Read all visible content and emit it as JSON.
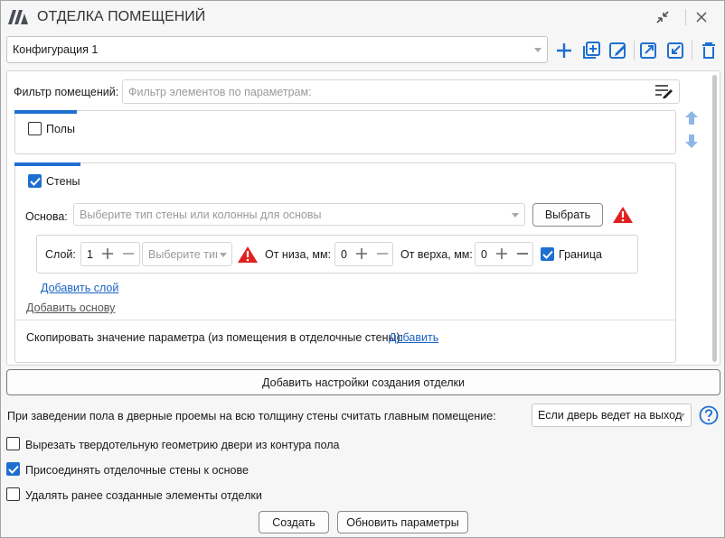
{
  "window": {
    "title": "ОТДЕЛКА ПОМЕЩЕНИЙ"
  },
  "config": {
    "selected": "Конфигурация 1"
  },
  "filter": {
    "label": "Фильтр помещений:",
    "placeholder": "Фильтр элементов по параметрам:"
  },
  "sections": {
    "floors": {
      "label": "Полы",
      "checked": false
    },
    "walls": {
      "label": "Стены",
      "checked": true,
      "base_label": "Основа:",
      "base_placeholder": "Выберите тип стены или колонны для основы",
      "choose_button": "Выбрать",
      "layer": {
        "label": "Слой:",
        "value": "1",
        "type_placeholder": "Выберите тип",
        "bottom_label": "От низа, мм:",
        "bottom_value": "0",
        "top_label": "От верха, мм:",
        "top_value": "0",
        "border_label": "Граница",
        "border_checked": true
      },
      "add_layer": "Добавить слой",
      "add_base": "Добавить основу",
      "copy_param_text": "Скопировать значение параметра (из помещения в отделочные стены):",
      "copy_param_link": "Добавить"
    }
  },
  "add_settings_button": "Добавить настройки создания отделки",
  "door_option": {
    "text": "При заведении пола в дверные проемы на всю толщину стены считать главным помещение:",
    "selected": "Если дверь ведет на выход"
  },
  "options": [
    {
      "label": "Вырезать твердотельную геометрию двери из контура пола",
      "checked": false
    },
    {
      "label": "Присоединять отделочные стены к основе",
      "checked": true
    },
    {
      "label": "Удалять ранее созданные элементы отделки",
      "checked": false
    }
  ],
  "footer": {
    "create": "Создать",
    "update": "Обновить параметры"
  },
  "colors": {
    "accent": "#1f6fd1",
    "warning": "#e02020",
    "link": "#1a63c4"
  }
}
